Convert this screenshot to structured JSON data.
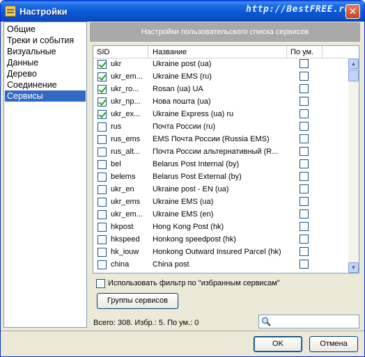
{
  "window": {
    "title": "Настройки",
    "watermark": "http://BestFREE.ru"
  },
  "nav": {
    "items": [
      {
        "label": "Общие",
        "selected": false
      },
      {
        "label": "Треки и события",
        "selected": false
      },
      {
        "label": "Визуальные",
        "selected": false
      },
      {
        "label": "Данные",
        "selected": false
      },
      {
        "label": "Дерево",
        "selected": false
      },
      {
        "label": "Соединение",
        "selected": false
      },
      {
        "label": "Сервисы",
        "selected": true
      }
    ]
  },
  "panel": {
    "header": "Настройки пользовательского списка сервисов",
    "columns": {
      "sid": "SID",
      "name": "Название",
      "default": "По ум."
    },
    "rows": [
      {
        "checked": true,
        "sid": "ukr",
        "name": "Ukraine post (ua)",
        "default": false
      },
      {
        "checked": true,
        "sid": "ukr_em...",
        "name": "Ukraine EMS (ru)",
        "default": false
      },
      {
        "checked": true,
        "sid": "ukr_ro...",
        "name": "Rosan (ua) UA",
        "default": false
      },
      {
        "checked": true,
        "sid": "ukr_пр...",
        "name": "Нова пошта (ua)",
        "default": false
      },
      {
        "checked": true,
        "sid": "ukr_ex...",
        "name": "Ukraine Express (ua) ru",
        "default": false
      },
      {
        "checked": false,
        "sid": "rus",
        "name": "Почта России (ru)",
        "default": false
      },
      {
        "checked": false,
        "sid": "rus_ems",
        "name": "EMS Почта России (Russia EMS)",
        "default": false
      },
      {
        "checked": false,
        "sid": "rus_alt...",
        "name": "Почта России альтернативный (R...",
        "default": false
      },
      {
        "checked": false,
        "sid": "bel",
        "name": "Belarus Post Internal (by)",
        "default": false
      },
      {
        "checked": false,
        "sid": "belems",
        "name": "Belarus Post External  (by)",
        "default": false
      },
      {
        "checked": false,
        "sid": "ukr_en",
        "name": "Ukraine post - EN (ua)",
        "default": false
      },
      {
        "checked": false,
        "sid": "ukr_ems",
        "name": "Ukraine EMS (ua)",
        "default": false
      },
      {
        "checked": false,
        "sid": "ukr_em...",
        "name": "Ukraine EMS (en)",
        "default": false
      },
      {
        "checked": false,
        "sid": "hkpost",
        "name": "Hong Kong Post (hk)",
        "default": false
      },
      {
        "checked": false,
        "sid": "hkspeed",
        "name": "Honkong speedpost (hk)",
        "default": false
      },
      {
        "checked": false,
        "sid": "hk_iouw",
        "name": "Honkong Outward Insured Parcel (hk)",
        "default": false
      },
      {
        "checked": false,
        "sid": "china",
        "name": "China post",
        "default": false
      }
    ],
    "filter_label": "Использовать фильтр по \"избранным сервисам\"",
    "filter_checked": false,
    "groups_button": "Группы сервисов",
    "status": "Всего: 308. Избр.: 5. По ум.: 0",
    "search_value": ""
  },
  "footer": {
    "ok_label": "OK",
    "cancel_label": "Отмена"
  },
  "icons": {
    "title": "settings-app-icon",
    "search": "magnifier-icon",
    "close": "close-icon"
  }
}
